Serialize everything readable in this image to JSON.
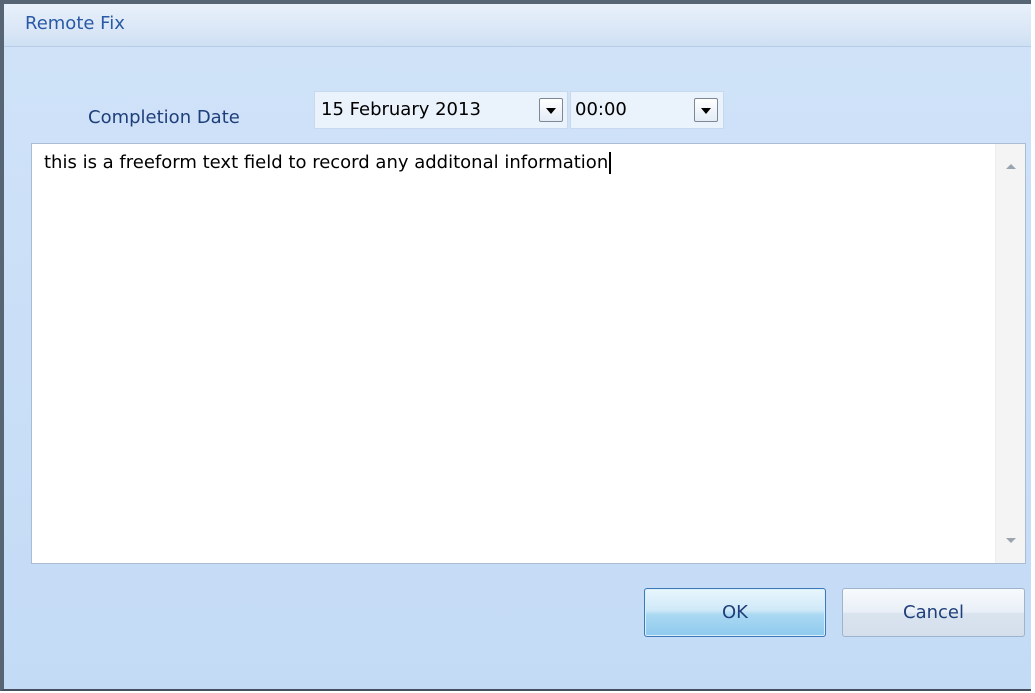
{
  "window": {
    "title": "Remote Fix"
  },
  "form": {
    "completion_date_label": "Completion Date",
    "date_value": "15 February 2013",
    "time_value": "00:00",
    "notes_value": "this is a freeform text field to record any additonal information"
  },
  "buttons": {
    "ok_label": "OK",
    "cancel_label": "Cancel"
  },
  "icons": {
    "date_dropdown": "chevron-down-icon",
    "time_dropdown": "chevron-down-icon",
    "scroll_up": "arrow-up-icon",
    "scroll_down": "arrow-down-icon"
  },
  "colors": {
    "title_text": "#2a5aa5",
    "label_text": "#1e3f7a",
    "client_background": "#c6dcf5",
    "ok_button": "#a9d8f2"
  }
}
